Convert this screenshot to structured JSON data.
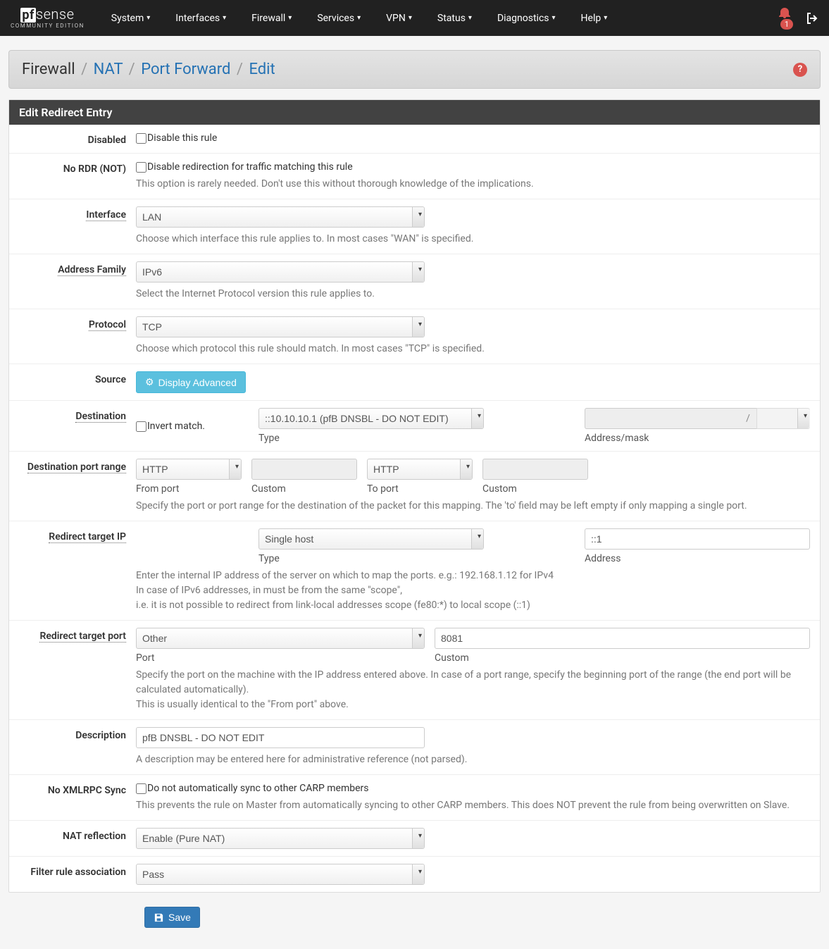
{
  "logo": {
    "pf": "pf",
    "sense": "sense",
    "sub": "COMMUNITY EDITION"
  },
  "nav": {
    "items": [
      "System",
      "Interfaces",
      "Firewall",
      "Services",
      "VPN",
      "Status",
      "Diagnostics",
      "Help"
    ],
    "notif_count": "1"
  },
  "breadcrumb": {
    "root": "Firewall",
    "a": "NAT",
    "b": "Port Forward",
    "c": "Edit"
  },
  "panel_title": "Edit Redirect Entry",
  "labels": {
    "disabled": "Disabled",
    "nordr": "No RDR (NOT)",
    "interface": "Interface",
    "af": "Address Family",
    "protocol": "Protocol",
    "source": "Source",
    "destination": "Destination",
    "dst_port_range": "Destination port range",
    "redir_ip": "Redirect target IP",
    "redir_port": "Redirect target port",
    "description": "Description",
    "noxmlrpc": "No XMLRPC Sync",
    "nat_refl": "NAT reflection",
    "filter_assoc": "Filter rule association"
  },
  "fields": {
    "disabled_text": "Disable this rule",
    "nordr_text": "Disable redirection for traffic matching this rule",
    "nordr_help": "This option is rarely needed. Don't use this without thorough knowledge of the implications.",
    "interface_value": "LAN",
    "interface_help": "Choose which interface this rule applies to. In most cases \"WAN\" is specified.",
    "af_value": "IPv6",
    "af_help": "Select the Internet Protocol version this rule applies to.",
    "protocol_value": "TCP",
    "protocol_help": "Choose which protocol this rule should match. In most cases \"TCP\" is specified.",
    "source_btn": "Display Advanced",
    "dst_invert": "Invert match.",
    "dst_type_value": "::10.10.10.1 (pfB DNSBL - DO NOT EDIT)",
    "dst_type_label": "Type",
    "dst_addr_label": "Address/mask",
    "dst_addr_value": "",
    "dst_mask_value": "",
    "slash": "/",
    "dpr_from_value": "HTTP",
    "dpr_from_label": "From port",
    "dpr_custom1_label": "Custom",
    "dpr_to_value": "HTTP",
    "dpr_to_label": "To port",
    "dpr_custom2_label": "Custom",
    "dpr_help": "Specify the port or port range for the destination of the packet for this mapping. The 'to' field may be left empty if only mapping a single port.",
    "rip_type_value": "Single host",
    "rip_type_label": "Type",
    "rip_addr_value": "::1",
    "rip_addr_label": "Address",
    "rip_help1": "Enter the internal IP address of the server on which to map the ports. e.g.: 192.168.1.12 for IPv4",
    "rip_help2": "In case of IPv6 addresses, in must be from the same \"scope\",",
    "rip_help3": "i.e. it is not possible to redirect from link-local addresses scope (fe80:*) to local scope (::1)",
    "rport_port_value": "Other",
    "rport_port_label": "Port",
    "rport_custom_value": "8081",
    "rport_custom_label": "Custom",
    "rport_help1": "Specify the port on the machine with the IP address entered above. In case of a port range, specify the beginning port of the range (the end port will be calculated automatically).",
    "rport_help2": "This is usually identical to the \"From port\" above.",
    "description_value": "pfB DNSBL - DO NOT EDIT",
    "description_help": "A description may be entered here for administrative reference (not parsed).",
    "noxmlrpc_text": "Do not automatically sync to other CARP members",
    "noxmlrpc_help": "This prevents the rule on Master from automatically syncing to other CARP members. This does NOT prevent the rule from being overwritten on Slave.",
    "nat_refl_value": "Enable (Pure NAT)",
    "filter_assoc_value": "Pass"
  },
  "buttons": {
    "save": "Save"
  }
}
